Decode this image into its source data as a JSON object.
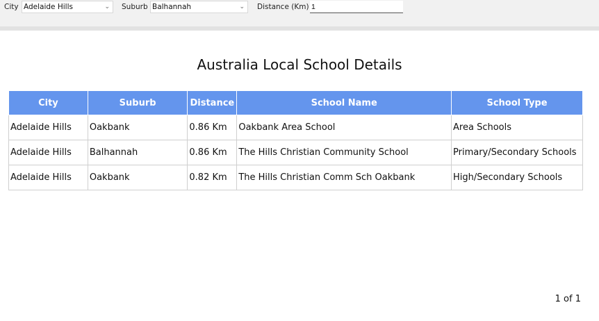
{
  "filters": {
    "city_label": "City",
    "city_value": "Adelaide Hills",
    "suburb_label": "Suburb",
    "suburb_value": "Balhannah",
    "distance_label": "Distance (Km)",
    "distance_value": "1"
  },
  "page_title": "Australia Local School Details",
  "table": {
    "headers": [
      "City",
      "Suburb",
      "Distance",
      "School Name",
      "School Type"
    ],
    "rows": [
      [
        "Adelaide Hills",
        "Oakbank",
        "0.86 Km",
        "Oakbank Area School",
        "Area Schools"
      ],
      [
        "Adelaide Hills",
        "Balhannah",
        "0.86 Km",
        "The Hills Christian Community School",
        "Primary/Secondary Schools"
      ],
      [
        "Adelaide Hills",
        "Oakbank",
        "0.82 Km",
        "The Hills Christian Comm Sch Oakbank",
        "High/Secondary Schools"
      ]
    ]
  },
  "pager": "1 of 1",
  "colors": {
    "header_bg": "#6495ed",
    "toolbar_bg": "#f1f1f1"
  },
  "icons": {
    "dropdown": "chevron-down-icon"
  }
}
